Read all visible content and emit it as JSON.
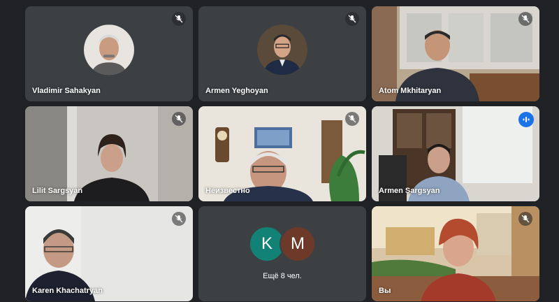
{
  "participants": [
    {
      "name": "Vladimir Sahakyan",
      "mic": "muted"
    },
    {
      "name": "Armen Yeghoyan",
      "mic": "muted"
    },
    {
      "name": "Atom Mkhitaryan",
      "mic": "muted"
    },
    {
      "name": "Lilit Sargsyan",
      "mic": "muted"
    },
    {
      "name": "Неизвестно",
      "mic": "muted"
    },
    {
      "name": "Armen Sargsyan",
      "mic": "speaking"
    },
    {
      "name": "Karen Khachatryan",
      "mic": "muted"
    },
    {
      "name": "Вы",
      "mic": "muted"
    }
  ],
  "more_tile": {
    "avatars": [
      {
        "letter": "K",
        "color": "#128277"
      },
      {
        "letter": "M",
        "color": "#6d3a2a"
      }
    ],
    "label": "Ещё 8 чел."
  },
  "colors": {
    "background": "#202124",
    "tile": "#3c4043",
    "active_border": "#8ab4f8",
    "speaking_badge": "#1a73e8"
  },
  "icons": {
    "muted": "mic-off-icon",
    "speaking": "audio-levels-icon"
  }
}
